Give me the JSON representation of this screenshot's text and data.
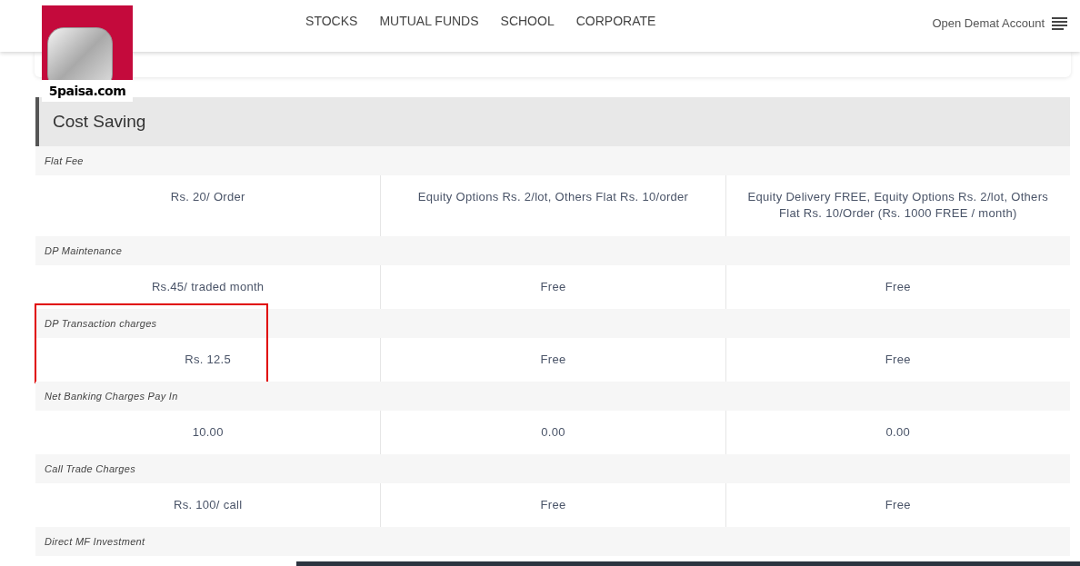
{
  "logo": {
    "text": "5paisa.com"
  },
  "nav": {
    "links": [
      "STOCKS",
      "MUTUAL FUNDS",
      "SCHOOL",
      "CORPORATE"
    ],
    "cta": "Open Demat Account"
  },
  "section": {
    "title": "Cost Saving"
  },
  "table": {
    "rows": [
      {
        "label": "Flat Fee",
        "highlight": false,
        "values": [
          "Rs. 20/ Order",
          "Equity Options Rs. 2/lot, Others Flat Rs. 10/order",
          "Equity Delivery FREE, Equity Options Rs. 2/lot, Others Flat Rs. 10/Order (Rs. 1000 FREE / month)"
        ]
      },
      {
        "label": "DP Maintenance",
        "highlight": false,
        "values": [
          "Rs.45/ traded month",
          "Free",
          "Free"
        ]
      },
      {
        "label": "DP Transaction charges",
        "highlight": true,
        "values": [
          "Rs. 12.5",
          "Free",
          "Free"
        ]
      },
      {
        "label": "Net Banking Charges Pay In",
        "highlight": false,
        "values": [
          "10.00",
          "0.00",
          "0.00"
        ]
      },
      {
        "label": "Call Trade Charges",
        "highlight": false,
        "values": [
          "Rs. 100/ call",
          "Free",
          "Free"
        ]
      },
      {
        "label": "Direct MF Investment",
        "highlight": false,
        "values": []
      }
    ]
  }
}
